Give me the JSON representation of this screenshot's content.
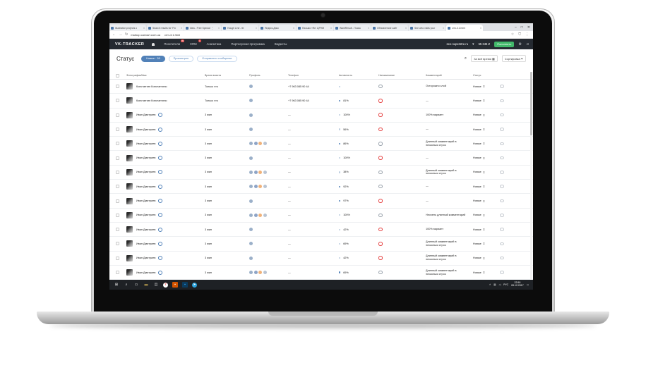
{
  "browser": {
    "tabs": [
      {
        "label": "Illustration projects o",
        "active": false
      },
      {
        "label": "Search results for 'Fin",
        "active": false
      },
      {
        "label": "Idea - Free Special ⋮",
        "active": false
      },
      {
        "label": "Hough Line - ttt",
        "active": false
      },
      {
        "label": "Яндекс.Диск",
        "active": false
      },
      {
        "label": "Письмо «Re: ЦРНМ",
        "active": false
      },
      {
        "label": "WantResult - Поиск",
        "active": false
      },
      {
        "label": "Обновления! сайт",
        "active": false
      },
      {
        "label": "See who visits your",
        "active": false
      },
      {
        "label": "crm-3.1.html",
        "active": true
      }
    ],
    "url_host": "markup.canvart.com.ua",
    "url_path": "crm-3.1.html",
    "controls": {
      "back": "←",
      "forward": "→",
      "reload": "↻",
      "minimize": "–",
      "maximize": "□",
      "close": "✕"
    }
  },
  "app": {
    "logo": "VK-TRACKER",
    "nav": [
      {
        "label": "Посетители",
        "badge": "99"
      },
      {
        "label": "CRM",
        "badge": "1"
      },
      {
        "label": "Аналитика",
        "badge": ""
      },
      {
        "label": "Партнерская программа",
        "badge": ""
      },
      {
        "label": "Виджеты",
        "badge": ""
      }
    ],
    "site": "seo-superstre.ru",
    "balance": "55 345 ₽",
    "topup": "Пополнить"
  },
  "toolbar": {
    "title": "Статус",
    "filters": [
      {
        "label": "Новые · 28",
        "active": true
      },
      {
        "label": "Просмотрен",
        "active": false
      },
      {
        "label": "Отправлено сообщение",
        "active": false
      }
    ],
    "period": "За всё время",
    "sort": "Сортировка"
  },
  "table": {
    "headers": [
      "Фотография/Имя",
      "Время визита",
      "Профиль",
      "Телефон",
      "Активность",
      "Напоминание",
      "Комментарий",
      "Статус"
    ],
    "rows": [
      {
        "name": "Константин Константино",
        "verified": false,
        "time": "Только что",
        "socials": [
          "vk"
        ],
        "phone": "+7 963 085 90 44",
        "activity": "",
        "active": false,
        "reminder_warn": false,
        "comment": "Осторожно злой",
        "status": "Новые"
      },
      {
        "name": "Константин Константино",
        "verified": false,
        "time": "Только что",
        "socials": [
          "vk"
        ],
        "phone": "+7 963 085 90 44",
        "activity": "81%",
        "active": true,
        "reminder_warn": true,
        "comment": "—",
        "status": "Новые"
      },
      {
        "name": "Иван Дмитриев",
        "verified": true,
        "time": "3 мин",
        "socials": [
          "vk"
        ],
        "phone": "—",
        "activity": "100%",
        "active": false,
        "reminder_warn": true,
        "comment": "100% вариант",
        "status": "Новые"
      },
      {
        "name": "Иван Дмитриев",
        "verified": true,
        "time": "3 мин",
        "socials": [
          "vk"
        ],
        "phone": "—",
        "activity": "56%",
        "active": false,
        "reminder_warn": true,
        "comment": "—",
        "status": "Новые"
      },
      {
        "name": "Иван Дмитриев",
        "verified": true,
        "time": "3 мин",
        "socials": [
          "vk",
          "fb",
          "ok",
          "mail"
        ],
        "phone": "—",
        "activity": "86%",
        "active": true,
        "reminder_warn": false,
        "comment": "Длинный комментарий в несколько строк",
        "status": "Новые"
      },
      {
        "name": "Иван Дмитриев",
        "verified": true,
        "time": "3 мин",
        "socials": [
          "vk"
        ],
        "phone": "—",
        "activity": "100%",
        "active": false,
        "reminder_warn": true,
        "comment": "—",
        "status": "Новые"
      },
      {
        "name": "Иван Дмитриев",
        "verified": true,
        "time": "3 мин",
        "socials": [
          "vk",
          "fb",
          "ok",
          "mail"
        ],
        "phone": "—",
        "activity": "38%",
        "active": false,
        "reminder_warn": false,
        "comment": "Длинный комментарий в несколько строк",
        "status": "Новые"
      },
      {
        "name": "Иван Дмитриев",
        "verified": true,
        "time": "3 мин",
        "socials": [
          "vk",
          "fb",
          "ok",
          "mail"
        ],
        "phone": "—",
        "activity": "92%",
        "active": true,
        "reminder_warn": false,
        "comment": "—",
        "status": "Новые"
      },
      {
        "name": "Иван Дмитриев",
        "verified": true,
        "time": "3 мин",
        "socials": [
          "vk"
        ],
        "phone": "—",
        "activity": "97%",
        "active": true,
        "reminder_warn": true,
        "comment": "—",
        "status": "Новые"
      },
      {
        "name": "Иван Дмитриев",
        "verified": true,
        "time": "3 мин",
        "socials": [
          "vk",
          "fb",
          "ok",
          "mail"
        ],
        "phone": "—",
        "activity": "100%",
        "active": false,
        "reminder_warn": false,
        "comment": "Неочень длинный комментарий",
        "status": "Новые"
      },
      {
        "name": "Иван Дмитриев",
        "verified": true,
        "time": "3 мин",
        "socials": [
          "vk"
        ],
        "phone": "—",
        "activity": "42%",
        "active": false,
        "reminder_warn": true,
        "comment": "100% вариант",
        "status": "Новые"
      },
      {
        "name": "Иван Дмитриев",
        "verified": true,
        "time": "3 мин",
        "socials": [
          "vk"
        ],
        "phone": "—",
        "activity": "69%",
        "active": false,
        "reminder_warn": true,
        "comment": "Длинный комментарий в несколько строк",
        "status": "Новые"
      },
      {
        "name": "Иван Дмитриев",
        "verified": true,
        "time": "3 мин",
        "socials": [
          "vk"
        ],
        "phone": "—",
        "activity": "42%",
        "active": false,
        "reminder_warn": true,
        "comment": "Длинный комментарий в несколько строк",
        "status": "Новые"
      },
      {
        "name": "Иван Дмитриев",
        "verified": true,
        "time": "3 мин",
        "socials": [
          "vk",
          "fb",
          "ok",
          "mail"
        ],
        "phone": "—",
        "activity": "69%",
        "active": true,
        "reminder_warn": false,
        "comment": "Длинный комментарий в несколько строк",
        "status": "Новые"
      },
      {
        "name": "Иван Дмитриев",
        "verified": true,
        "time": "3 мин",
        "socials": [
          "vk"
        ],
        "phone": "—",
        "activity": "42%",
        "active": true,
        "reminder_warn": false,
        "comment": "Неочень длинный комментарий",
        "status": "Новые"
      }
    ]
  },
  "taskbar": {
    "lang": "РУС",
    "time": "22:50",
    "date": "05.12.2017"
  },
  "colors": {
    "accent": "#5181b8",
    "header": "#252a31",
    "green": "#42b86a",
    "warn": "#e64646"
  }
}
